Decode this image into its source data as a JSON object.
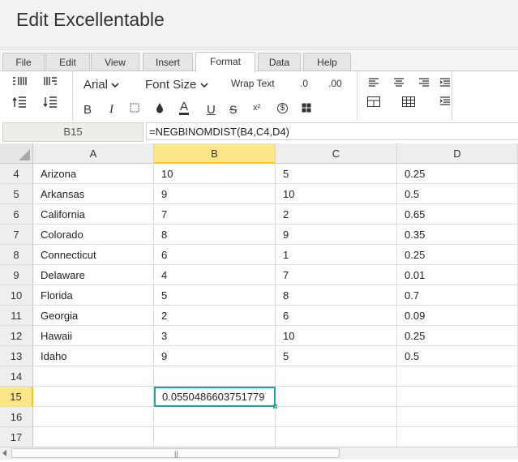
{
  "app": {
    "title": "Edit Excellentable"
  },
  "tabs": [
    "File",
    "Edit",
    "View",
    "Insert",
    "Format",
    "Data",
    "Help"
  ],
  "active_tab": "Format",
  "ribbon": {
    "font_family": "Arial",
    "font_size": "Font Size",
    "wrap_text": "Wrap Text",
    "decimal_decrease": ".0",
    "decimal_increase": ".00",
    "bold": "B",
    "italic": "I",
    "font_color": "A",
    "underline": "U",
    "strikethrough": "S",
    "superscript": "x²",
    "currency": "$",
    "icons": [
      "insert-rows-icon",
      "insert-columns-icon",
      "indent-icon",
      "outdent-icon",
      "cell-style-icon",
      "fill-color-icon",
      "merge-cells-icon",
      "align-left-icon",
      "align-center-icon",
      "align-right-icon",
      "align-justify-icon",
      "borders-icon",
      "table-icon",
      "wrap-icon"
    ],
    "accent_color": "#26a69a"
  },
  "formula_bar": {
    "cell_ref": "B15",
    "formula": "=NEGBINOMDIST(B4,C4,D4)"
  },
  "sheet": {
    "columns": [
      "A",
      "B",
      "C",
      "D"
    ],
    "selected_column": "B",
    "selected_row": "15",
    "rows": [
      {
        "num": "4",
        "A": "Arizona",
        "B": "10",
        "C": "5",
        "D": "0.25"
      },
      {
        "num": "5",
        "A": "Arkansas",
        "B": "9",
        "C": "10",
        "D": "0.5"
      },
      {
        "num": "6",
        "A": "California",
        "B": "7",
        "C": "2",
        "D": "0.65"
      },
      {
        "num": "7",
        "A": "Colorado",
        "B": "8",
        "C": "9",
        "D": "0.35"
      },
      {
        "num": "8",
        "A": "Connecticut",
        "B": "6",
        "C": "1",
        "D": "0.25"
      },
      {
        "num": "9",
        "A": "Delaware",
        "B": "4",
        "C": "7",
        "D": "0.01"
      },
      {
        "num": "10",
        "A": "Florida",
        "B": "5",
        "C": "8",
        "D": "0.7"
      },
      {
        "num": "11",
        "A": "Georgia",
        "B": "2",
        "C": "6",
        "D": "0.09"
      },
      {
        "num": "12",
        "A": "Hawaii",
        "B": "3",
        "C": "10",
        "D": "0.25"
      },
      {
        "num": "13",
        "A": "Idaho",
        "B": "9",
        "C": "5",
        "D": "0.5"
      },
      {
        "num": "14",
        "A": "",
        "B": "",
        "C": "",
        "D": ""
      },
      {
        "num": "15",
        "A": "",
        "B": "0.0550486603751779",
        "C": "",
        "D": ""
      },
      {
        "num": "16",
        "A": "",
        "B": "",
        "C": "",
        "D": ""
      },
      {
        "num": "17",
        "A": "",
        "B": "",
        "C": "",
        "D": ""
      }
    ]
  },
  "scrollbar": {
    "grip": "||"
  }
}
